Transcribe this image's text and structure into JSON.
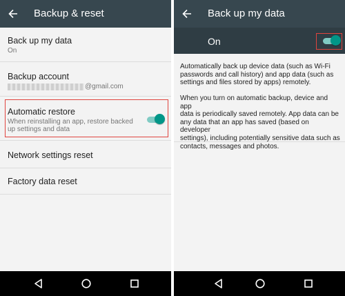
{
  "left_screen": {
    "title": "Backup & reset",
    "items": [
      {
        "title": "Back up my data",
        "subtitle": "On"
      },
      {
        "title": "Backup account",
        "subtitle": "@gmail.com"
      },
      {
        "title": "Automatic restore",
        "subtitle_line1": "When reinstalling an app, restore backed",
        "subtitle_line2": "up settings and data",
        "toggle_on": true
      },
      {
        "title": "Network settings reset"
      },
      {
        "title": "Factory data reset"
      }
    ]
  },
  "right_screen": {
    "title": "Back up my data",
    "switch_label": "On",
    "switch_on": true,
    "paragraph1": [
      "Automatically back up device data (such as Wi-Fi",
      "passwords and call history) and app data (such as",
      "settings and files stored by apps) remotely."
    ],
    "paragraph2": [
      "When you turn on automatic backup, device and app",
      "data is periodically saved remotely. App data can be",
      "any data that an app has saved (based on developer",
      "settings), including potentially sensitive data such as",
      "contacts, messages and photos."
    ]
  },
  "colors": {
    "app_bar": "#37474f",
    "switch_bar": "#2f3d44",
    "accent": "#009688",
    "highlight": "#e0443e"
  },
  "icons": {
    "back": "arrow-left-icon",
    "nav_back": "triangle-back-icon",
    "nav_home": "circle-home-icon",
    "nav_recents": "square-recents-icon"
  }
}
